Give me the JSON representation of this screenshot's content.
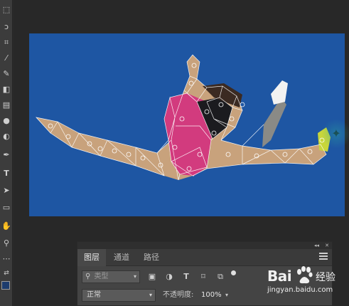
{
  "layers_panel": {
    "tabs": [
      {
        "label": "图层",
        "active": true
      },
      {
        "label": "通道",
        "active": false
      },
      {
        "label": "路径",
        "active": false
      }
    ],
    "filter": {
      "kind_placeholder": "类型",
      "icons": [
        "image-filter-icon",
        "adjustment-filter-icon",
        "type-filter-icon",
        "shape-filter-icon",
        "smart-object-filter-icon",
        "filter-toggle-icon"
      ]
    },
    "blend_mode": "正常",
    "opacity_label": "不透明度:",
    "opacity_value": "100%"
  },
  "toolbar": {
    "tools": [
      "marquee-icon",
      "lasso-icon",
      "crop-icon",
      "eyedropper-icon",
      "brush-icon",
      "clone-icon",
      "eraser-icon",
      "gradient-icon",
      "blur-icon",
      "dodge-icon",
      "pen-icon",
      "type-icon",
      "path-select-icon",
      "rectangle-icon",
      "hand-icon",
      "zoom-icon",
      "more-tools-icon",
      "swap-colors-icon"
    ],
    "foreground_color": "#1d3c6d",
    "background_color": "#1b1b1b"
  },
  "canvas": {
    "background_color": "#1e56a3",
    "cursor_icon": "pin-icon"
  },
  "watermark": {
    "brand_text": "Bai",
    "brand_suffix": "经验",
    "url": "jingyan.baidu.com"
  }
}
